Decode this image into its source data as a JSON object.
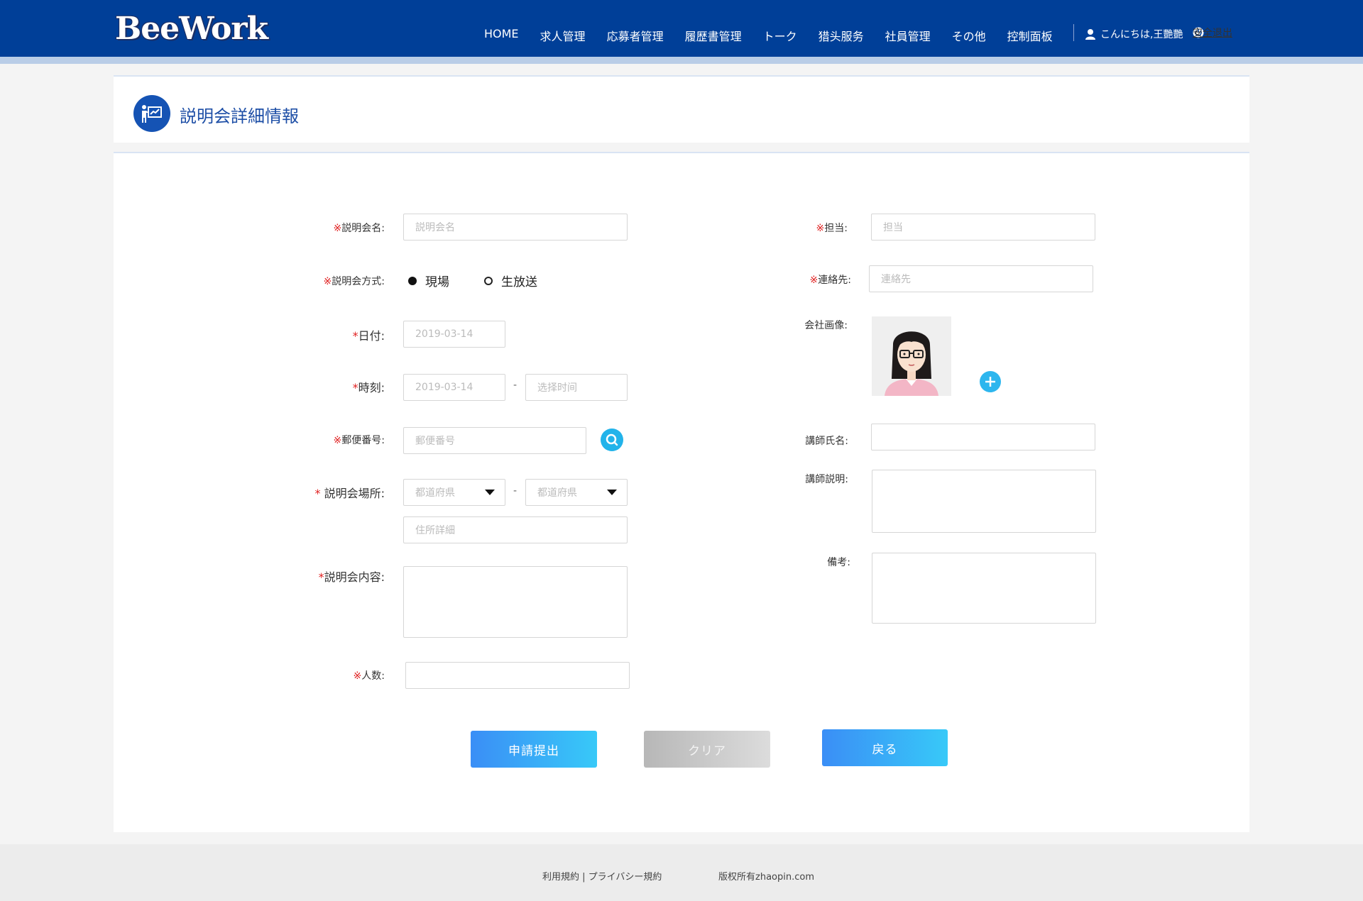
{
  "header": {
    "logo": "BeeWork",
    "nav": [
      "HOME",
      "求人管理",
      "応募者管理",
      "履歴書管理",
      "トーク",
      "猎头服务",
      "社員管理",
      "その他",
      "控制面板"
    ],
    "greeting": "こんにちは,王艷艷",
    "logout": "安全退出",
    "bg_color": "#003f98"
  },
  "page": {
    "title": "説明会詳細情報",
    "icon": "presentation-icon"
  },
  "form": {
    "name": {
      "label": "説明会名",
      "req": "※",
      "placeholder": "説明会名"
    },
    "method": {
      "label": "説明会方式",
      "req": "※",
      "options": [
        "現場",
        "生放送"
      ],
      "selected": "現場"
    },
    "date": {
      "label": "日付",
      "req": "*",
      "value": "2019-03-14"
    },
    "time": {
      "label": "時刻",
      "req": "*",
      "start": "2019-03-14",
      "end_placeholder": "选择时间",
      "sep": "-"
    },
    "postal": {
      "label": "郵便番号",
      "req": "※",
      "placeholder": "郵便番号"
    },
    "place": {
      "label": "説明会場所",
      "req": "*",
      "pref1": "都道府県",
      "pref2": "都道府県",
      "detail": "住所詳細",
      "sep": "-"
    },
    "content": {
      "label": "説明会内容",
      "req": "*"
    },
    "people": {
      "label": "人数",
      "req": "※"
    },
    "staff": {
      "label": "担当",
      "req": "※",
      "placeholder": "担当"
    },
    "contact": {
      "label": "連絡先",
      "req": "※",
      "placeholder": "連絡先"
    },
    "company_image": {
      "label": "会社画像"
    },
    "lecturer_name": {
      "label": "講師氏名"
    },
    "lecturer_desc": {
      "label": "講師説明"
    },
    "remarks": {
      "label": "備考"
    },
    "colon": ":"
  },
  "buttons": {
    "submit": "申請提出",
    "clear": "クリア",
    "back": "戻る"
  },
  "footer": {
    "links": "利用規約 | プライバシー規約",
    "copyright": "版权所有zhaopin.com"
  }
}
